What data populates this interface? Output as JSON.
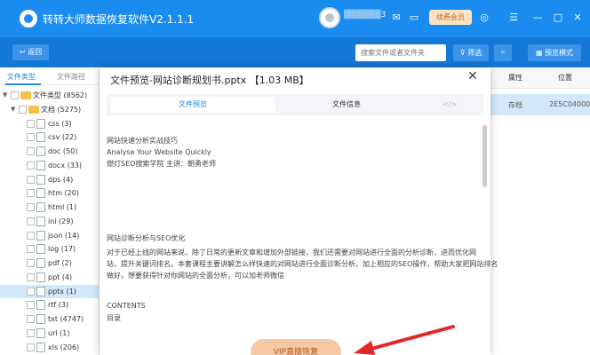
{
  "app": {
    "title": "转转大师数据恢复软件V2.1.1.1",
    "user_name": "▒▒▒▒▒▒3",
    "vip_label": "续费会员"
  },
  "toolbar": {
    "back_label": "返回",
    "search_placeholder": "搜索文件或者文件夹",
    "filter_label": "筛选",
    "scan_label": "",
    "preview_mode_label": "预览模式"
  },
  "sidebar": {
    "tab_type": "文件类型",
    "tab_path": "文件路径",
    "root": "文件类型 (8562)",
    "docs": "文档 (5275)",
    "items": [
      "css (3)",
      "csv (22)",
      "doc (50)",
      "docx (33)",
      "dps (4)",
      "htm (20)",
      "html (1)",
      "ini (29)",
      "json (14)",
      "log (17)",
      "pdf (2)",
      "ppt (4)",
      "pptx (1)",
      "rtf (3)",
      "txt (4747)",
      "url (1)",
      "xls (206)"
    ]
  },
  "right_panel": {
    "col_attr": "属性",
    "col_pos": "位置",
    "row_attr": "存档",
    "row_pos": "2E5C04000"
  },
  "dialog": {
    "title": "文件预览-网站诊断规划书.pptx 【1.03 MB】",
    "tab_preview": "文件预览",
    "tab_info": "文件信息",
    "code_icon": "</>",
    "lines": [
      "网站快速分析实战技巧",
      "Analyse Your Website Quickly",
      "燃灯SEO搜索学院  主讲：朝勇老师",
      "网站诊断分析与SEO优化",
      "对于已经上线的网站来说，除了日常的更新文章和增加外部链接，我们还需要对网站进行全面的分析诊断，进而优化网",
      "站，提升关键词排名。本套课程主要讲解怎么样快速的对网站进行全面诊断分析，加上相应的SEO操作，帮助大家把网站排名",
      "做好。想要获得针对你网站的全面分析，可以加老师微信",
      "CONTENTS",
      "目录"
    ],
    "vip_restore_label": "VIP直接恢复"
  },
  "colors": {
    "title_bar": "#1a8cf0",
    "toolbar": "#1378d6",
    "accent": "#1a8cf0",
    "arrow": "#e02a2a"
  }
}
